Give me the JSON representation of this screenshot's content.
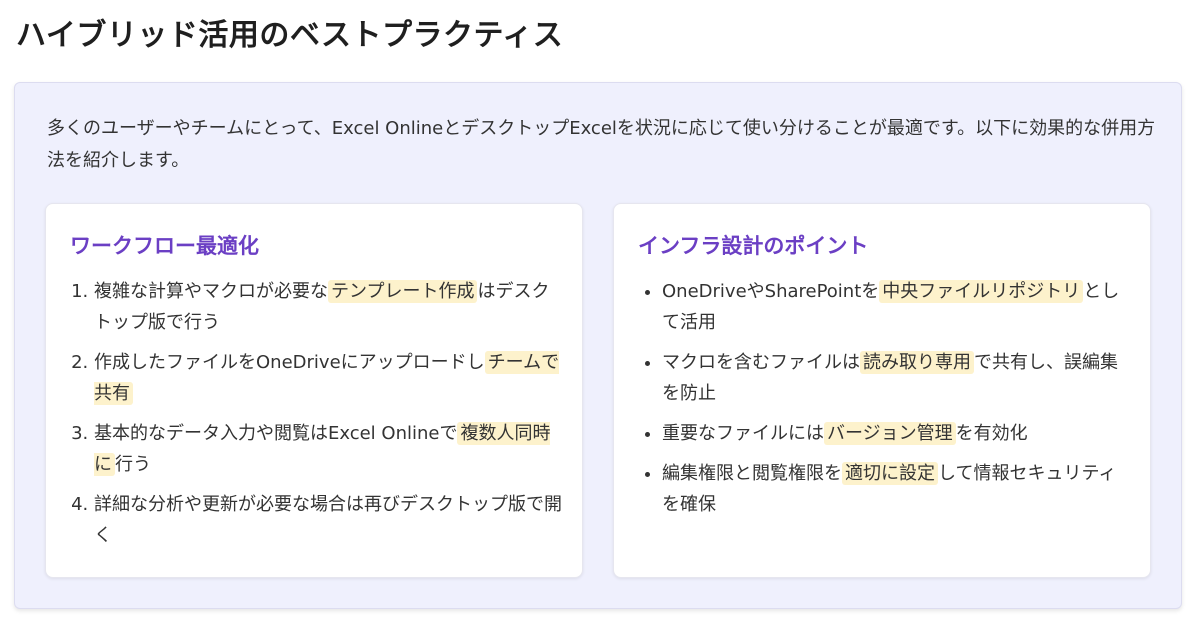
{
  "page": {
    "title": "ハイブリッド活用のベストプラクティス"
  },
  "intro": {
    "text": "多くのユーザーやチームにとって、Excel OnlineとデスクトップExcelを状況に応じて使い分けることが最適です。以下に効果的な併用方法を紹介します。"
  },
  "workflow": {
    "title": "ワークフロー最適化",
    "items": [
      {
        "before": "複雑な計算やマクロが必要な",
        "highlight": "テンプレート作成",
        "after": "はデスクトップ版で行う"
      },
      {
        "before": "作成したファイルをOneDriveにアップロードし",
        "highlight": "チームで共有",
        "after": ""
      },
      {
        "before": "基本的なデータ入力や閲覧はExcel Onlineで",
        "highlight": "複数人同時に",
        "after": "行う"
      },
      {
        "before": "詳細な分析や更新が必要な場合は再びデスクトップ版で開く",
        "highlight": "",
        "after": ""
      }
    ]
  },
  "infra": {
    "title": "インフラ設計のポイント",
    "items": [
      {
        "before": "OneDriveやSharePointを",
        "highlight": "中央ファイルリポジトリ",
        "after": "として活用"
      },
      {
        "before": "マクロを含むファイルは",
        "highlight": "読み取り専用",
        "after": "で共有し、誤編集を防止"
      },
      {
        "before": "重要なファイルには",
        "highlight": "バージョン管理",
        "after": "を有効化"
      },
      {
        "before": "編集権限と閲覧権限を",
        "highlight": "適切に設定",
        "after": "して情報セキュリティを確保"
      }
    ]
  },
  "colors": {
    "card_title": "#6b3fc4",
    "panel_background": "#eff0fd",
    "highlight": "#fdf2cc"
  }
}
